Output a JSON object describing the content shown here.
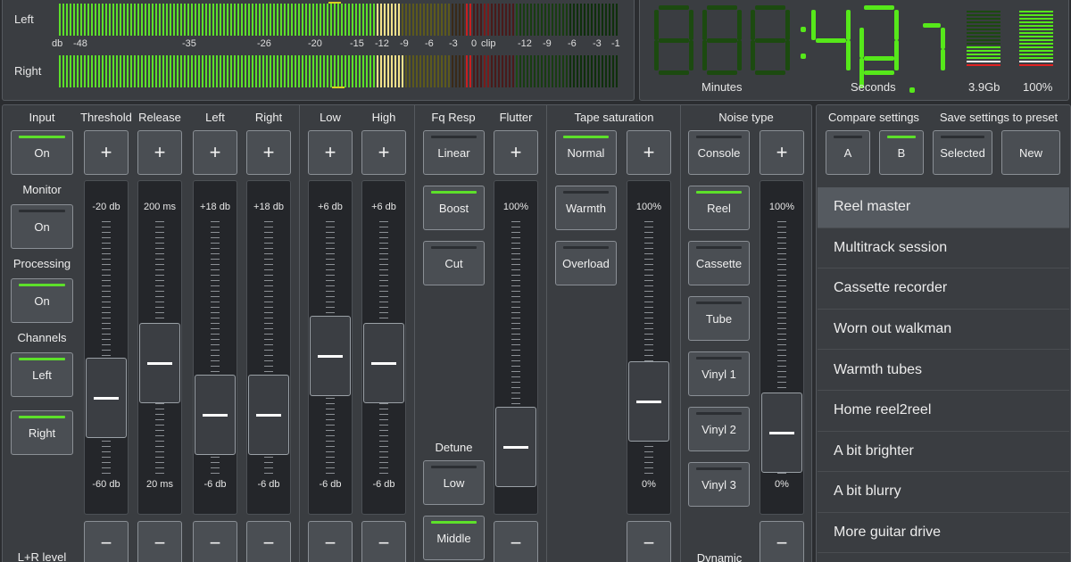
{
  "meters": {
    "left_label": "Left",
    "right_label": "Right",
    "scale_db": "db",
    "scale_values": [
      "-48",
      "-35",
      "-26",
      "-20",
      "-15",
      "-12",
      "-9",
      "-6",
      "-3",
      "0",
      "clip"
    ],
    "scale_values_right": [
      "-12",
      "-9",
      "-6",
      "-3",
      "-1"
    ],
    "colors": {
      "green": "#5de02a",
      "yellow": "#f2e18a",
      "dim": "#5d5a1c",
      "red": "#c82020"
    }
  },
  "clock": {
    "display": "000:48.7",
    "minutes_label": "Minutes",
    "seconds_label": "Seconds",
    "disk_label": "3.9Gb",
    "battery_label": "100%",
    "color": "#56e81a"
  },
  "left_controls": {
    "input_label": "Input",
    "input_btn": "On",
    "monitor_label": "Monitor",
    "monitor_btn": "On",
    "processing_label": "Processing",
    "processing_btn": "On",
    "channels_label": "Channels",
    "channels_left": "Left",
    "channels_right": "Right",
    "lr_level_label": "L+R level"
  },
  "columns": {
    "threshold": {
      "label": "Threshold",
      "top": "-20 db",
      "bottom": "-60 db",
      "level": 0.38
    },
    "release": {
      "label": "Release",
      "top": "200 ms",
      "bottom": "20 ms",
      "level": 0.58
    },
    "left": {
      "label": "Left",
      "top": "+18 db",
      "bottom": "-6 db",
      "level": 0.28
    },
    "right": {
      "label": "Right",
      "top": "+18 db",
      "bottom": "-6 db",
      "level": 0.28
    },
    "low": {
      "label": "Low",
      "top": "+6 db",
      "bottom": "-6 db",
      "level": 0.62
    },
    "high": {
      "label": "High",
      "top": "+6 db",
      "bottom": "-6 db",
      "level": 0.58
    },
    "flutter": {
      "label": "Flutter",
      "top": "100%",
      "bottom": "0%",
      "level": 0.1
    },
    "saturation": {
      "top": "100%",
      "bottom": "0%",
      "level": 0.36
    },
    "noise": {
      "top": "100%",
      "bottom": "0%",
      "level": 0.18
    }
  },
  "plus": "+",
  "minus": "−",
  "fq_resp": {
    "label": "Fq Resp",
    "linear": "Linear",
    "boost": "Boost",
    "cut": "Cut"
  },
  "detune": {
    "label": "Detune",
    "low": "Low",
    "middle": "Middle"
  },
  "tape": {
    "label": "Tape saturation",
    "normal": "Normal",
    "warmth": "Warmth",
    "overload": "Overload"
  },
  "noise": {
    "label": "Noise type",
    "items": [
      "Console",
      "Reel",
      "Cassette",
      "Tube",
      "Vinyl 1",
      "Vinyl 2",
      "Vinyl 3"
    ],
    "dynamic_label": "Dynamic"
  },
  "compare": {
    "label": "Compare settings",
    "a": "A",
    "b": "B"
  },
  "save": {
    "label": "Save settings to preset",
    "selected": "Selected",
    "new": "New"
  },
  "presets": [
    "Reel master",
    "Multitrack session",
    "Cassette recorder",
    "Worn out walkman",
    "Warmth tubes",
    "Home reel2reel",
    "A bit brighter",
    "A bit blurry",
    "More guitar drive"
  ]
}
